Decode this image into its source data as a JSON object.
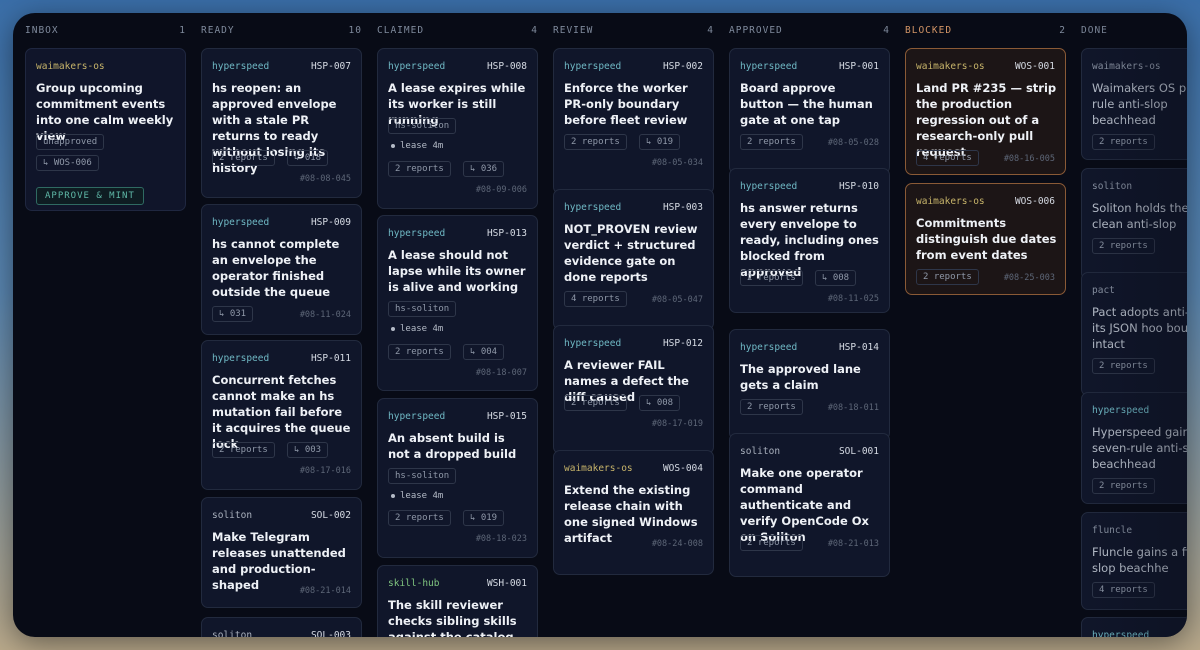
{
  "columns": [
    {
      "name": "INBOX",
      "count": "1"
    },
    {
      "name": "READY",
      "count": "10"
    },
    {
      "name": "CLAIMED",
      "count": "4"
    },
    {
      "name": "REVIEW",
      "count": "4"
    },
    {
      "name": "APPROVED",
      "count": "4"
    },
    {
      "name": "BLOCKED",
      "count": "2"
    },
    {
      "name": "DONE",
      "count": ""
    }
  ],
  "inbox": {
    "card1": {
      "project": "waimakers-os",
      "title": "Group upcoming commitment events into one calm weekly view",
      "status": "unapproved",
      "link": "↳ WOS-006",
      "action": "APPROVE & MINT"
    }
  },
  "ready": {
    "card1": {
      "project": "hyperspeed",
      "id": "HSP-007",
      "title": "hs reopen: an approved envelope with a stale PR returns to ready without losing its history",
      "reports": "2 reports",
      "link": "↳ 018",
      "ref": "#08-08-045"
    },
    "card2": {
      "project": "hyperspeed",
      "id": "HSP-009",
      "title": "hs cannot complete an envelope the operator finished outside the queue",
      "link": "↳ 031",
      "ref": "#08-11-024"
    },
    "card3": {
      "project": "hyperspeed",
      "id": "HSP-011",
      "title": "Concurrent fetches cannot make an hs mutation fail before it acquires the queue lock",
      "reports": "2 reports",
      "link": "↳ 003",
      "ref": "#08-17-016"
    },
    "card4": {
      "project": "soliton",
      "id": "SOL-002",
      "title": "Make Telegram releases unattended and production-shaped",
      "ref": "#08-21-014"
    },
    "card5": {
      "project": "soliton",
      "id": "SOL-003"
    }
  },
  "claimed": {
    "card1": {
      "project": "hyperspeed",
      "id": "HSP-008",
      "title": "A lease expires while its worker is still running",
      "agent": "hs-soliton",
      "lease": "lease 4m",
      "reports": "2 reports",
      "link": "↳ 036",
      "ref": "#08-09-006"
    },
    "card2": {
      "project": "hyperspeed",
      "id": "HSP-013",
      "title": "A lease should not lapse while its owner is alive and working",
      "agent": "hs-soliton",
      "lease": "lease 4m",
      "reports": "2 reports",
      "link": "↳ 004",
      "ref": "#08-18-007"
    },
    "card3": {
      "project": "hyperspeed",
      "id": "HSP-015",
      "title": "An absent build is not a dropped build",
      "agent": "hs-soliton",
      "lease": "lease 4m",
      "reports": "2 reports",
      "link": "↳ 019",
      "ref": "#08-18-023"
    },
    "card4": {
      "project": "skill-hub",
      "id": "WSH-001",
      "title": "The skill reviewer checks sibling skills against the catalog"
    }
  },
  "review": {
    "card1": {
      "project": "hyperspeed",
      "id": "HSP-002",
      "title": "Enforce the worker PR-only boundary before fleet review",
      "reports": "2 reports",
      "link": "↳ 019",
      "ref": "#08-05-034"
    },
    "card2": {
      "project": "hyperspeed",
      "id": "HSP-003",
      "title": "NOT_PROVEN review verdict + structured evidence gate on done reports",
      "reports": "4 reports",
      "ref": "#08-05-047"
    },
    "card3": {
      "project": "hyperspeed",
      "id": "HSP-012",
      "title": "A reviewer FAIL names a defect the diff caused",
      "reports": "2 reports",
      "link": "↳ 008",
      "ref": "#08-17-019"
    },
    "card4": {
      "project": "waimakers-os",
      "id": "WOS-004",
      "title": "Extend the existing release chain with one signed Windows artifact",
      "ref": "#08-24-008"
    }
  },
  "approved": {
    "card1": {
      "project": "hyperspeed",
      "id": "HSP-001",
      "title": "Board approve button — the human gate at one tap",
      "reports": "2 reports",
      "ref": "#08-05-028"
    },
    "card2": {
      "project": "hyperspeed",
      "id": "HSP-010",
      "title": "hs answer returns every envelope to ready, including ones blocked from approved",
      "reports": "2 reports",
      "link": "↳ 008",
      "ref": "#08-11-025"
    },
    "card3": {
      "project": "hyperspeed",
      "id": "HSP-014",
      "title": "The approved lane gets a claim",
      "reports": "2 reports",
      "ref": "#08-18-011"
    },
    "card4": {
      "project": "soliton",
      "id": "SOL-001",
      "title": "Make one operator command authenticate and verify OpenCode Ox on Soliton",
      "reports": "2 reports",
      "ref": "#08-21-013"
    }
  },
  "blocked": {
    "card1": {
      "project": "waimakers-os",
      "id": "WOS-001",
      "title": "Land PR #235 — strip the production regression out of a research-only pull request",
      "reports": "4 reports",
      "ref": "#08-16-005"
    },
    "card2": {
      "project": "waimakers-os",
      "id": "WOS-006",
      "title": "Commitments distinguish due dates from event dates",
      "reports": "2 reports",
      "ref": "#08-25-003"
    }
  },
  "done": {
    "card1": {
      "project": "waimakers-os",
      "title": "Waimakers OS pro six-rule anti-slop beachhead",
      "reports": "2 reports"
    },
    "card2": {
      "project": "soliton",
      "title": "Soliton holds the l six clean anti-slop",
      "reports": "2 reports"
    },
    "card3": {
      "project": "pact",
      "title": "Pact adopts anti-s with its JSON hoo boundary intact",
      "reports": "2 reports"
    },
    "card4": {
      "project": "hyperspeed",
      "title": "Hyperspeed gains seven-rule anti-slo beachhead",
      "reports": "2 reports"
    },
    "card5": {
      "project": "fluncle",
      "title": "Fluncle gains a fiv anti-slop beachhe",
      "reports": "4 reports"
    },
    "card6": {
      "project": "hyperspeed"
    }
  },
  "colors": {
    "accent_hyperspeed": "#6fb8c4",
    "accent_waimakers": "#c7b46a",
    "blocked_border": "#8a5a36",
    "approve_button": "#5fb9a8"
  }
}
